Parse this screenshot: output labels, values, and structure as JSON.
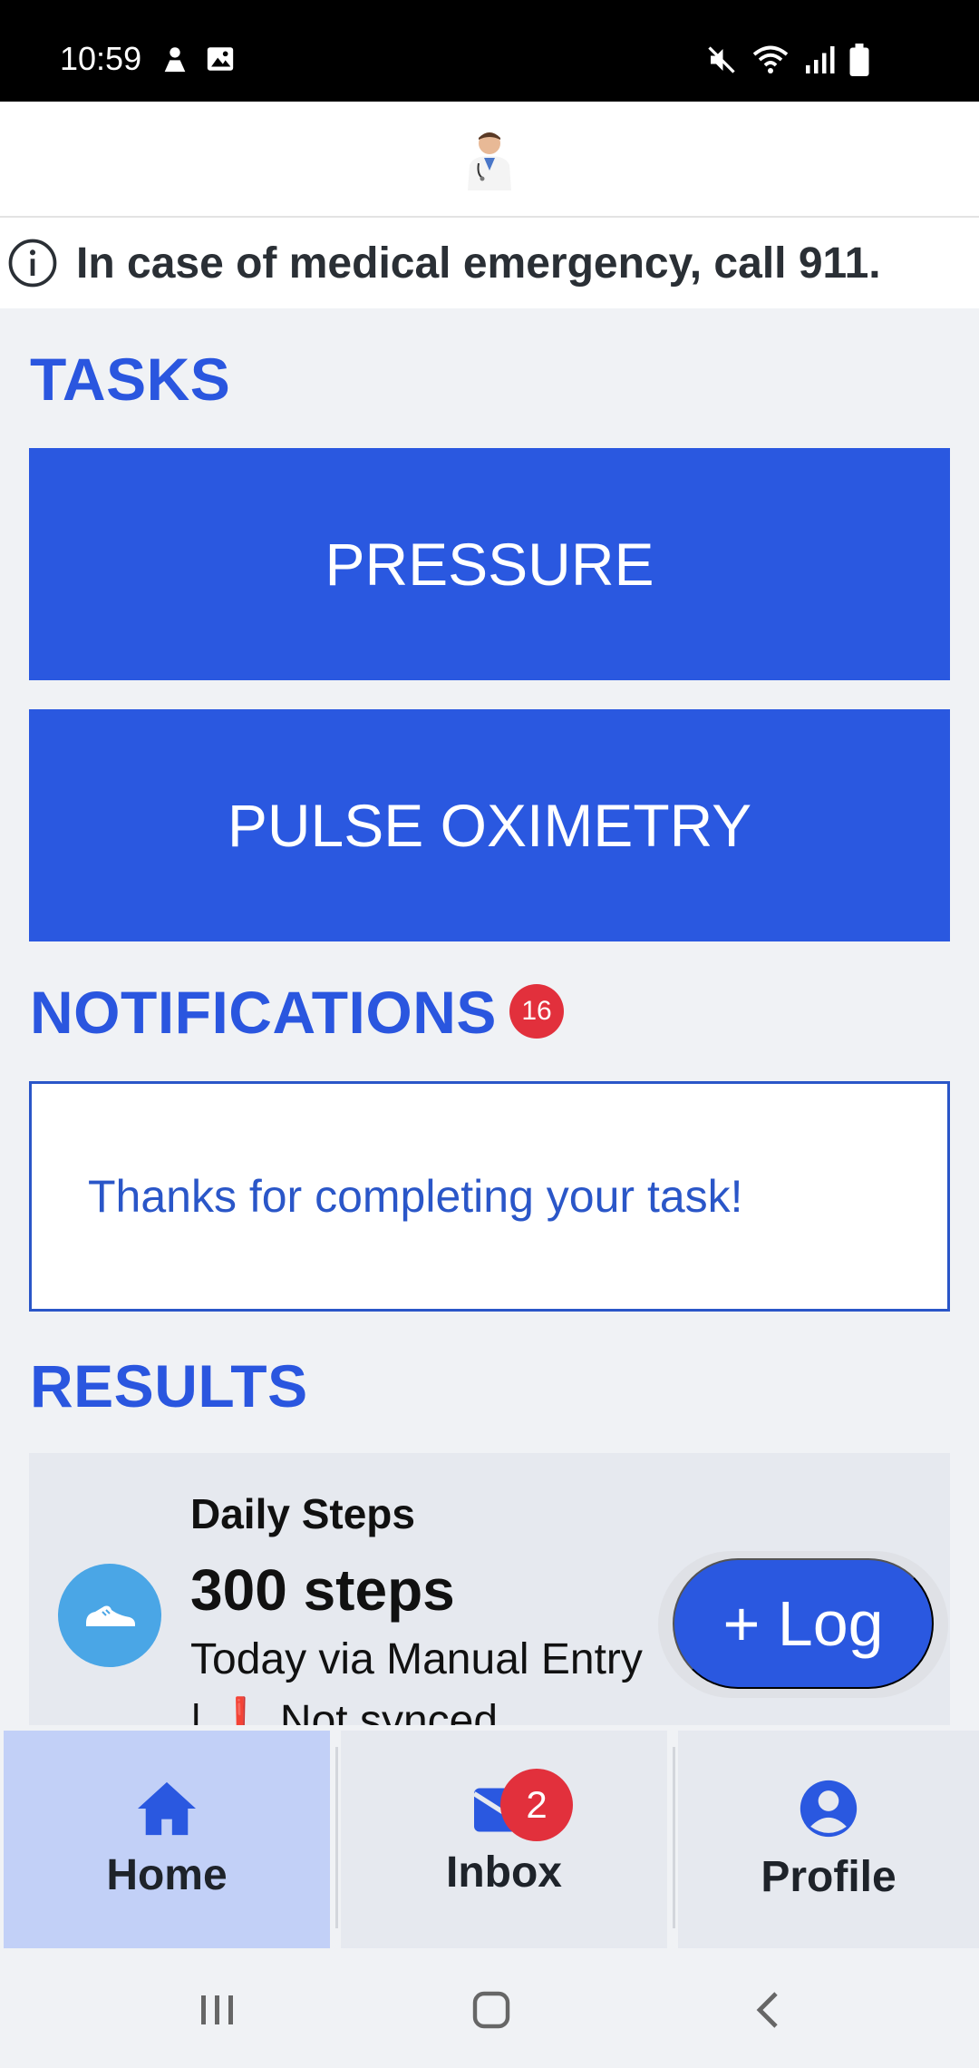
{
  "status_bar": {
    "time": "10:59"
  },
  "header": {
    "logo_icon": "doctor-avatar-icon"
  },
  "banner": {
    "text": "In case of medical emergency, call 911."
  },
  "tasks": {
    "title": "TASKS",
    "buttons": [
      {
        "label": "PRESSURE"
      },
      {
        "label": "PULSE OXIMETRY"
      }
    ]
  },
  "notifications": {
    "title": "NOTIFICATIONS",
    "count": "16",
    "message": "Thanks for completing your task!"
  },
  "results": {
    "title": "RESULTS",
    "card": {
      "title": "Daily Steps",
      "value": "300 steps",
      "subtitle": "Today via Manual Entry",
      "sync_status": "| ❗ Not synced"
    },
    "log_button": "+ Log"
  },
  "bottom_nav": {
    "tabs": [
      {
        "label": "Home",
        "icon": "home-icon",
        "active": true
      },
      {
        "label": "Inbox",
        "icon": "mail-icon",
        "badge": "2"
      },
      {
        "label": "Profile",
        "icon": "user-circle-icon"
      }
    ]
  },
  "colors": {
    "accent": "#2a58e0",
    "badge": "#e2303c",
    "active_tab": "#c2d0f7"
  }
}
